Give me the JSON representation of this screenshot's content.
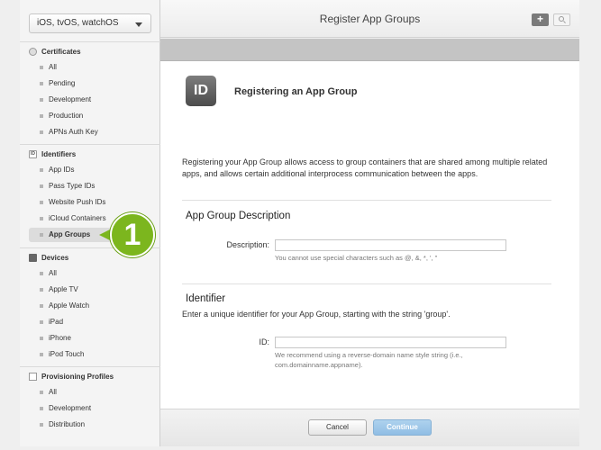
{
  "sidebar": {
    "platform_select": "iOS, tvOS, watchOS",
    "sections": {
      "certificates": {
        "title": "Certificates",
        "items": [
          "All",
          "Pending",
          "Development",
          "Production",
          "APNs Auth Key"
        ]
      },
      "identifiers": {
        "title": "Identifiers",
        "items": [
          "App IDs",
          "Pass Type IDs",
          "Website Push IDs",
          "iCloud Containers",
          "App Groups"
        ]
      },
      "devices": {
        "title": "Devices",
        "items": [
          "All",
          "Apple TV",
          "Apple Watch",
          "iPad",
          "iPhone",
          "iPod Touch"
        ]
      },
      "provisioning": {
        "title": "Provisioning Profiles",
        "items": [
          "All",
          "Development",
          "Distribution"
        ]
      }
    },
    "active_item": "App Groups",
    "callout_number": "1"
  },
  "header": {
    "title": "Register App Groups",
    "add_label": "+"
  },
  "main": {
    "tile_text": "ID",
    "heading": "Registering an App Group",
    "intro": "Registering your App Group allows access to group containers that are shared among multiple related apps, and allows certain additional interprocess communication between the apps.",
    "description_section": {
      "title": "App Group Description",
      "label": "Description:",
      "value": "",
      "hint": "You cannot use special characters such as @, &, *, ', \""
    },
    "identifier_section": {
      "title": "Identifier",
      "subtitle": "Enter a unique identifier for your App Group, starting with the string 'group'.",
      "label": "ID:",
      "value": "",
      "hint": "We recommend using a reverse-domain name style string (i.e., com.domainname.appname)."
    }
  },
  "footer": {
    "cancel_label": "Cancel",
    "continue_label": "Continue"
  },
  "colors": {
    "callout": "#7cb61e",
    "continue_button": "#9fc8ea",
    "tile": "#5e5e5e"
  }
}
